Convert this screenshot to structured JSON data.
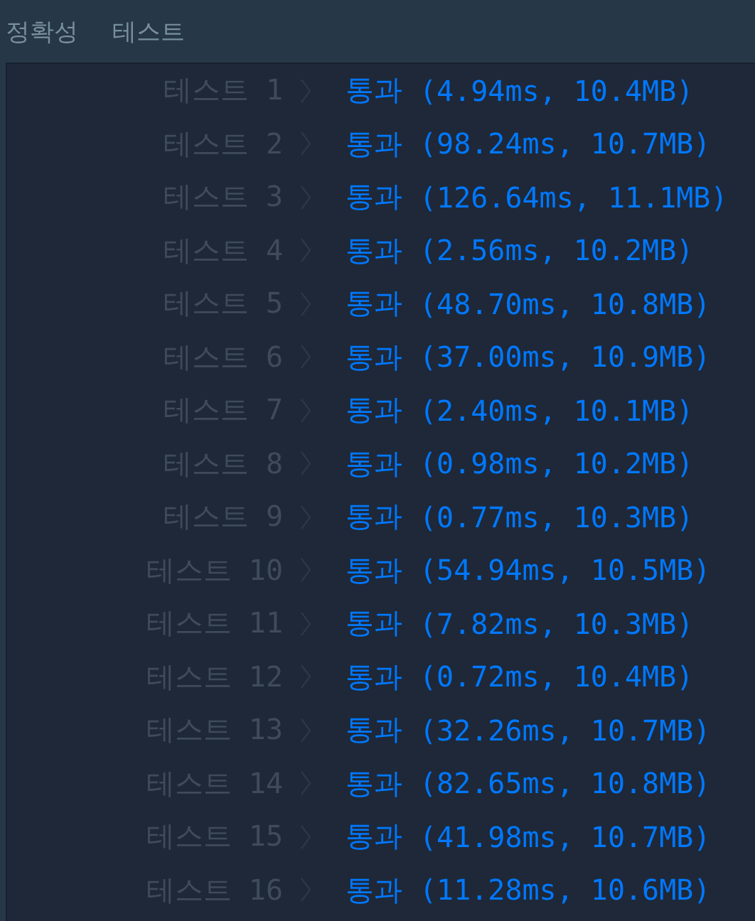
{
  "header": {
    "section": "정확성",
    "title": "테스트"
  },
  "tests": [
    {
      "label": "테스트 1",
      "result": "통과",
      "detail": "(4.94ms, 10.4MB)"
    },
    {
      "label": "테스트 2",
      "result": "통과",
      "detail": "(98.24ms, 10.7MB)"
    },
    {
      "label": "테스트 3",
      "result": "통과",
      "detail": "(126.64ms, 11.1MB)"
    },
    {
      "label": "테스트 4",
      "result": "통과",
      "detail": "(2.56ms, 10.2MB)"
    },
    {
      "label": "테스트 5",
      "result": "통과",
      "detail": "(48.70ms, 10.8MB)"
    },
    {
      "label": "테스트 6",
      "result": "통과",
      "detail": "(37.00ms, 10.9MB)"
    },
    {
      "label": "테스트 7",
      "result": "통과",
      "detail": "(2.40ms, 10.1MB)"
    },
    {
      "label": "테스트 8",
      "result": "통과",
      "detail": "(0.98ms, 10.2MB)"
    },
    {
      "label": "테스트 9",
      "result": "통과",
      "detail": "(0.77ms, 10.3MB)"
    },
    {
      "label": "테스트 10",
      "result": "통과",
      "detail": "(54.94ms, 10.5MB)"
    },
    {
      "label": "테스트 11",
      "result": "통과",
      "detail": "(7.82ms, 10.3MB)"
    },
    {
      "label": "테스트 12",
      "result": "통과",
      "detail": "(0.72ms, 10.4MB)"
    },
    {
      "label": "테스트 13",
      "result": "통과",
      "detail": "(32.26ms, 10.7MB)"
    },
    {
      "label": "테스트 14",
      "result": "통과",
      "detail": "(82.65ms, 10.8MB)"
    },
    {
      "label": "테스트 15",
      "result": "통과",
      "detail": "(41.98ms, 10.7MB)"
    },
    {
      "label": "테스트 16",
      "result": "통과",
      "detail": "(11.28ms, 10.6MB)"
    }
  ]
}
